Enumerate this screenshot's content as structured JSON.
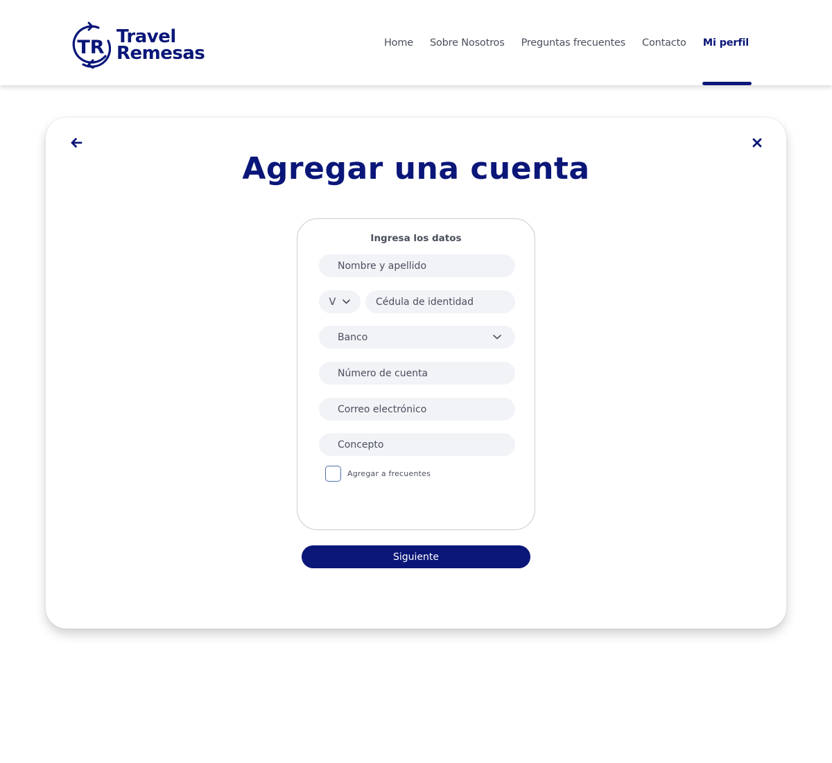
{
  "brand": {
    "mark_text": "TR",
    "name_line1": "Travel",
    "name_line2": "Remesas",
    "color": "#0a1678"
  },
  "nav": {
    "items": [
      {
        "label": "Home",
        "active": false
      },
      {
        "label": "Sobre Nosotros",
        "active": false
      },
      {
        "label": "Preguntas frecuentes",
        "active": false
      },
      {
        "label": "Contacto",
        "active": false
      },
      {
        "label": "Mi perfil",
        "active": true
      }
    ]
  },
  "dialog": {
    "back_icon": "arrow-left-icon",
    "close_icon": "close-icon",
    "title": "Agregar una cuenta"
  },
  "form": {
    "heading": "Ingresa los datos",
    "name_placeholder": "Nombre y apellido",
    "doc_type_value": "V",
    "id_placeholder": "Cédula de identidad",
    "bank_placeholder": "Banco",
    "account_placeholder": "Número de cuenta",
    "email_placeholder": "Correo electrónico",
    "concept_placeholder": "Concepto",
    "favorites_label": "Agregar a frecuentes",
    "favorites_checked": false,
    "submit_label": "Siguiente"
  },
  "colors": {
    "primary": "#0a1678",
    "field_bg": "#f1f3f7",
    "text": "#4a4f5c"
  }
}
